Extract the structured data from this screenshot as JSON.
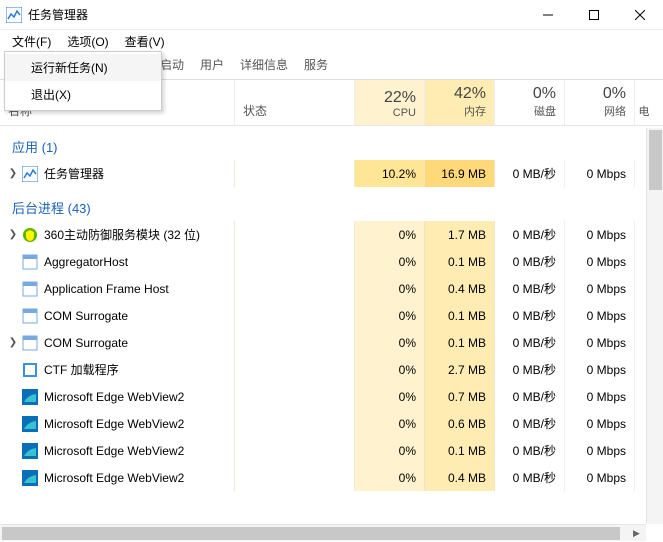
{
  "window": {
    "title": "任务管理器"
  },
  "menu": {
    "file": "文件(F)",
    "options": "选项(O)",
    "view": "查看(V)"
  },
  "dropdown": {
    "run_new_task": "运行新任务(N)",
    "exit": "退出(X)"
  },
  "tabs": {
    "startup_tail": "启动",
    "users": "用户",
    "details": "详细信息",
    "services": "服务"
  },
  "columns": {
    "name": "名称",
    "status": "状态",
    "cpu_pct": "22%",
    "cpu_label": "CPU",
    "mem_pct": "42%",
    "mem_label": "内存",
    "disk_pct": "0%",
    "disk_label": "磁盘",
    "net_pct": "0%",
    "net_label": "网络",
    "tail": "电"
  },
  "groups": {
    "apps": "应用 (1)",
    "bg": "后台进程 (43)"
  },
  "rows": [
    {
      "name": "任务管理器",
      "expandable": true,
      "cpu": "10.2%",
      "mem": "16.9 MB",
      "disk": "0 MB/秒",
      "net": "0 Mbps",
      "hi": true,
      "icon": "taskmgr"
    },
    {
      "name": "360主动防御服务模块 (32 位)",
      "expandable": true,
      "cpu": "0%",
      "mem": "1.7 MB",
      "disk": "0 MB/秒",
      "net": "0 Mbps",
      "icon": "shield"
    },
    {
      "name": "AggregatorHost",
      "expandable": false,
      "cpu": "0%",
      "mem": "0.1 MB",
      "disk": "0 MB/秒",
      "net": "0 Mbps",
      "icon": "generic"
    },
    {
      "name": "Application Frame Host",
      "expandable": false,
      "cpu": "0%",
      "mem": "0.4 MB",
      "disk": "0 MB/秒",
      "net": "0 Mbps",
      "icon": "generic"
    },
    {
      "name": "COM Surrogate",
      "expandable": false,
      "cpu": "0%",
      "mem": "0.1 MB",
      "disk": "0 MB/秒",
      "net": "0 Mbps",
      "icon": "generic"
    },
    {
      "name": "COM Surrogate",
      "expandable": true,
      "cpu": "0%",
      "mem": "0.1 MB",
      "disk": "0 MB/秒",
      "net": "0 Mbps",
      "icon": "generic"
    },
    {
      "name": "CTF 加载程序",
      "expandable": false,
      "cpu": "0%",
      "mem": "2.7 MB",
      "disk": "0 MB/秒",
      "net": "0 Mbps",
      "icon": "ctf"
    },
    {
      "name": "Microsoft Edge WebView2",
      "expandable": false,
      "cpu": "0%",
      "mem": "0.7 MB",
      "disk": "0 MB/秒",
      "net": "0 Mbps",
      "icon": "edge"
    },
    {
      "name": "Microsoft Edge WebView2",
      "expandable": false,
      "cpu": "0%",
      "mem": "0.6 MB",
      "disk": "0 MB/秒",
      "net": "0 Mbps",
      "icon": "edge"
    },
    {
      "name": "Microsoft Edge WebView2",
      "expandable": false,
      "cpu": "0%",
      "mem": "0.1 MB",
      "disk": "0 MB/秒",
      "net": "0 Mbps",
      "icon": "edge"
    },
    {
      "name": "Microsoft Edge WebView2",
      "expandable": false,
      "cpu": "0%",
      "mem": "0.4 MB",
      "disk": "0 MB/秒",
      "net": "0 Mbps",
      "icon": "edge"
    }
  ]
}
